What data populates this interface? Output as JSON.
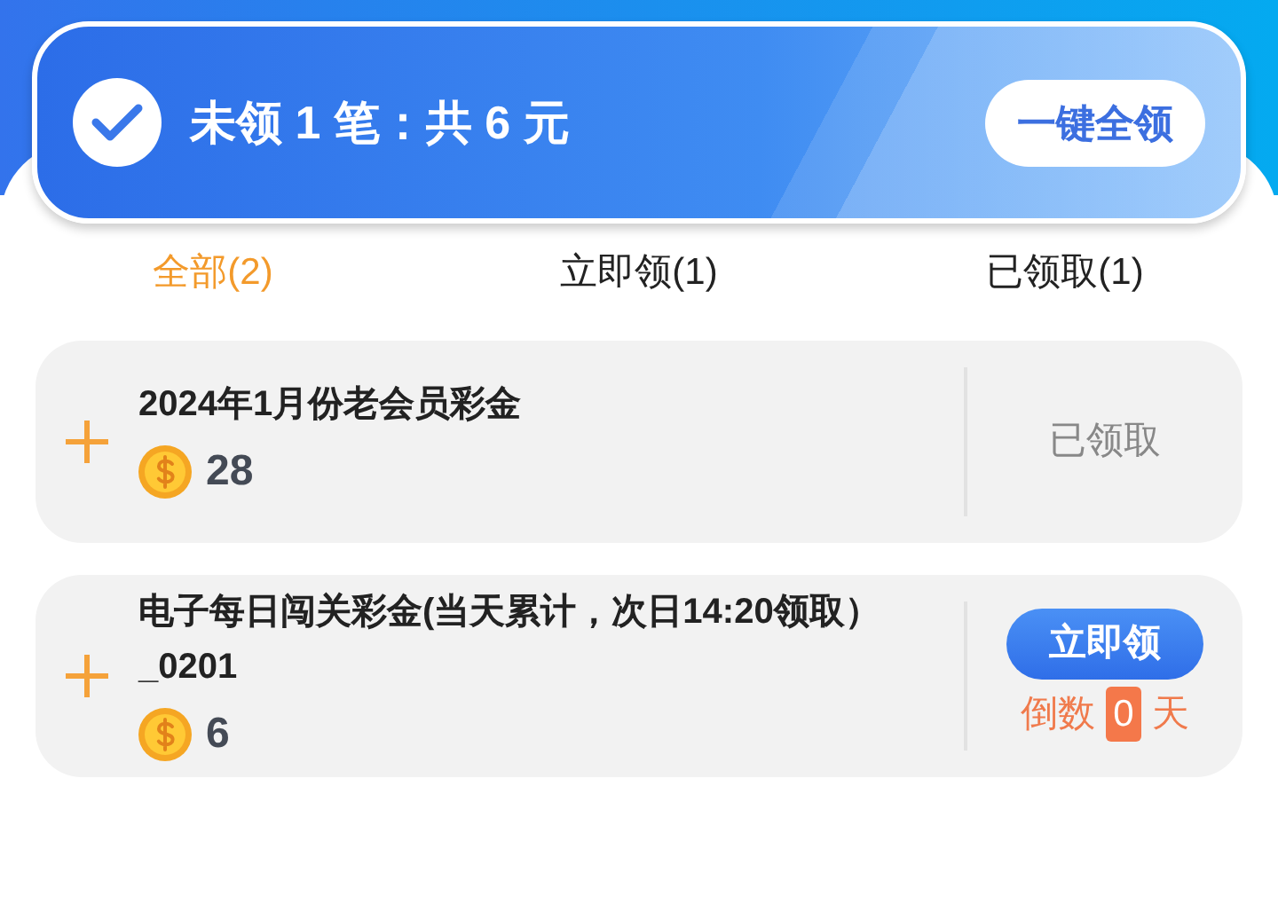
{
  "summary": {
    "text": "未领 1 笔：共 6 元"
  },
  "claim_all_button": "一键全领",
  "tabs": [
    {
      "label": "全部(2)",
      "selected": true
    },
    {
      "label": "立即领(1)",
      "selected": false
    },
    {
      "label": "已领取(1)",
      "selected": false
    }
  ],
  "rewards": [
    {
      "kind": "claimed",
      "title": "2024年1月份老会员彩金",
      "amount": "28",
      "status": "已领取"
    },
    {
      "kind": "claimable",
      "title": "电子每日闯关彩金(当天累计，次日14:20领取）_0201",
      "amount": "6",
      "button": "立即领",
      "countdown_prefix": "倒数",
      "countdown_value": "0",
      "countdown_suffix": "天"
    }
  ]
}
